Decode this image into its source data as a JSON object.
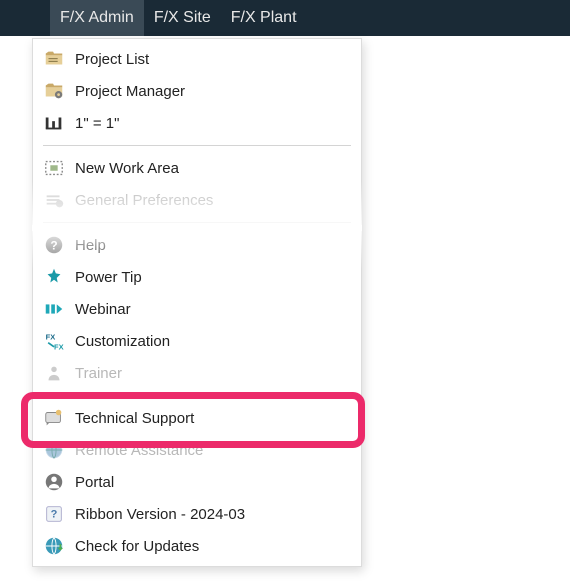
{
  "menubar": {
    "items": [
      {
        "label": "F/X Admin",
        "active": true
      },
      {
        "label": "F/X Site",
        "active": false
      },
      {
        "label": "F/X Plant",
        "active": false
      }
    ]
  },
  "menu": {
    "groups": [
      [
        {
          "icon": "folder-list-icon",
          "label": "Project List"
        },
        {
          "icon": "folder-gear-icon",
          "label": "Project Manager"
        },
        {
          "icon": "scale-icon",
          "label": "1\" = 1\""
        }
      ],
      [
        {
          "icon": "work-area-icon",
          "label": "New Work Area"
        },
        {
          "icon": "prefs-icon",
          "label": "General Preferences",
          "faded": true
        }
      ],
      [
        {
          "icon": "help-icon",
          "label": "Help"
        },
        {
          "icon": "power-tip-icon",
          "label": "Power Tip"
        },
        {
          "icon": "webinar-icon",
          "label": "Webinar"
        },
        {
          "icon": "customization-icon",
          "label": "Customization"
        },
        {
          "icon": "trainer-icon",
          "label": "Trainer",
          "faded": true
        }
      ],
      [
        {
          "icon": "tech-support-icon",
          "label": "Technical Support",
          "highlighted": true
        },
        {
          "icon": "remote-assist-icon",
          "label": "Remote Assistance",
          "faded": true
        },
        {
          "icon": "portal-icon",
          "label": "Portal"
        },
        {
          "icon": "version-icon",
          "label": "Ribbon Version - 2024-03"
        },
        {
          "icon": "update-icon",
          "label": "Check for Updates"
        }
      ]
    ]
  },
  "colors": {
    "highlight": "#ec2a6a",
    "menubar_bg": "#1a2a36",
    "menubar_active": "#3a4a56"
  }
}
